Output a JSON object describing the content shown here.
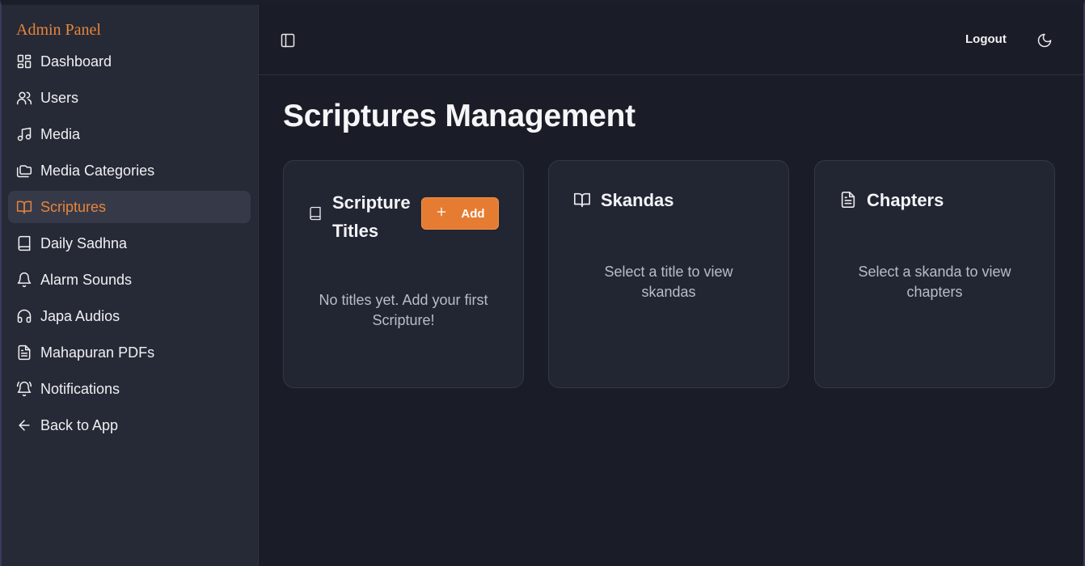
{
  "sidebar": {
    "brand": "Admin Panel",
    "items": [
      {
        "label": "Dashboard",
        "icon": "layout-grid-icon"
      },
      {
        "label": "Users",
        "icon": "users-icon"
      },
      {
        "label": "Media",
        "icon": "music-note-icon"
      },
      {
        "label": "Media Categories",
        "icon": "folders-icon"
      },
      {
        "label": "Scriptures",
        "icon": "open-book-icon",
        "active": true
      },
      {
        "label": "Daily Sadhna",
        "icon": "book-icon"
      },
      {
        "label": "Alarm Sounds",
        "icon": "bell-icon"
      },
      {
        "label": "Japa Audios",
        "icon": "headphones-icon"
      },
      {
        "label": "Mahapuran PDFs",
        "icon": "file-text-icon"
      },
      {
        "label": "Notifications",
        "icon": "bell-ring-icon"
      },
      {
        "label": "Back to App",
        "icon": "arrow-left-icon"
      }
    ]
  },
  "topbar": {
    "toggle_icon": "sidebar-toggle-icon",
    "logout_label": "Logout",
    "theme_icon": "moon-icon"
  },
  "main": {
    "page_title": "Scriptures Management",
    "cards": [
      {
        "title": "Scripture Titles",
        "icon": "book-icon",
        "add_label": "Add",
        "message": "No titles yet. Add your first Scripture!"
      },
      {
        "title": "Skandas",
        "icon": "open-book-icon",
        "message": "Select a title to view skandas"
      },
      {
        "title": "Chapters",
        "icon": "file-text-icon",
        "message": "Select a skanda to view chapters"
      }
    ]
  },
  "colors": {
    "accent": "#e57c31",
    "background": "#1a1d27",
    "sidebar": "#262a36",
    "card": "#222633"
  }
}
